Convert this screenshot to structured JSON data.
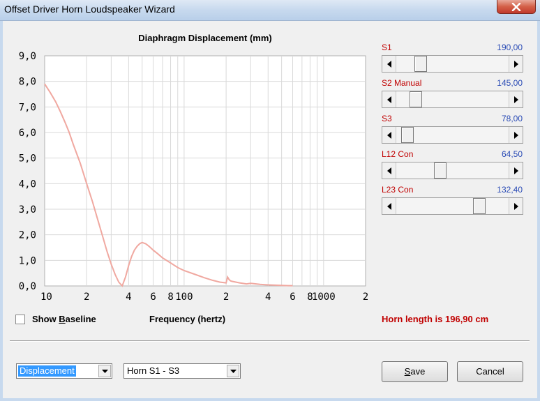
{
  "window": {
    "title": "Offset Driver Horn Loudspeaker Wizard",
    "close_icon": "close-icon"
  },
  "chart_data": {
    "type": "line",
    "title": "Diaphragm Displacement (mm)",
    "xlabel": "Frequency (hertz)",
    "ylabel": "",
    "xscale": "log",
    "xlim": [
      10,
      2000
    ],
    "ylim": [
      0,
      9
    ],
    "grid": true,
    "ytick_labels": [
      "0,0",
      "1,0",
      "2,0",
      "3,0",
      "4,0",
      "5,0",
      "6,0",
      "7,0",
      "8,0",
      "9,0"
    ],
    "xtick_labels": [
      {
        "x": 10,
        "label": "10"
      },
      {
        "x": 20,
        "label": "2"
      },
      {
        "x": 40,
        "label": "4"
      },
      {
        "x": 60,
        "label": "6"
      },
      {
        "x": 80,
        "label": "8"
      },
      {
        "x": 100,
        "label": "100"
      },
      {
        "x": 200,
        "label": "2"
      },
      {
        "x": 400,
        "label": "4"
      },
      {
        "x": 600,
        "label": "6"
      },
      {
        "x": 800,
        "label": "8"
      },
      {
        "x": 1000,
        "label": "1000"
      },
      {
        "x": 2000,
        "label": "2"
      }
    ],
    "line_color": "#f0a8a0",
    "series": [
      {
        "x": [
          10,
          11,
          12,
          13,
          14,
          15,
          16,
          18,
          20,
          22,
          24,
          26,
          28,
          30,
          32,
          34,
          36,
          38,
          40,
          42,
          44,
          46,
          48,
          50,
          53,
          56,
          60,
          65,
          70,
          80,
          90,
          100,
          120,
          140,
          160,
          180,
          200,
          205,
          210,
          215,
          220,
          250,
          280,
          300,
          350,
          400,
          450,
          500,
          560,
          600
        ],
        "y": [
          7.9,
          7.55,
          7.2,
          6.8,
          6.4,
          6.0,
          5.55,
          4.8,
          4.0,
          3.3,
          2.6,
          1.95,
          1.35,
          0.85,
          0.45,
          0.15,
          0.0,
          0.35,
          0.8,
          1.15,
          1.4,
          1.55,
          1.65,
          1.7,
          1.65,
          1.55,
          1.4,
          1.25,
          1.1,
          0.9,
          0.72,
          0.6,
          0.45,
          0.32,
          0.22,
          0.15,
          0.12,
          0.35,
          0.25,
          0.2,
          0.18,
          0.12,
          0.08,
          0.1,
          0.06,
          0.04,
          0.03,
          0.02,
          0.01,
          0.01
        ]
      }
    ]
  },
  "checkbox": {
    "label_before": "Show ",
    "label_underline": "B",
    "label_after": "aseline",
    "checked": false
  },
  "sliders": [
    {
      "label": "S1",
      "value": "190,00",
      "level": 0.18
    },
    {
      "label": "S2 Manual",
      "value": "145,00",
      "level": 0.13
    },
    {
      "label": "S3",
      "value": "78,00",
      "level": 0.05
    },
    {
      "label": "L12 Con",
      "value": "64,50",
      "level": 0.38
    },
    {
      "label": "L23 Con",
      "value": "132,40",
      "level": 0.77
    }
  ],
  "horn_length": "Horn length is 196,90 cm",
  "combos": {
    "mode": "Displacement",
    "section": "Horn S1 - S3"
  },
  "buttons": {
    "save_underline": "S",
    "save_rest": "ave",
    "cancel": "Cancel"
  }
}
